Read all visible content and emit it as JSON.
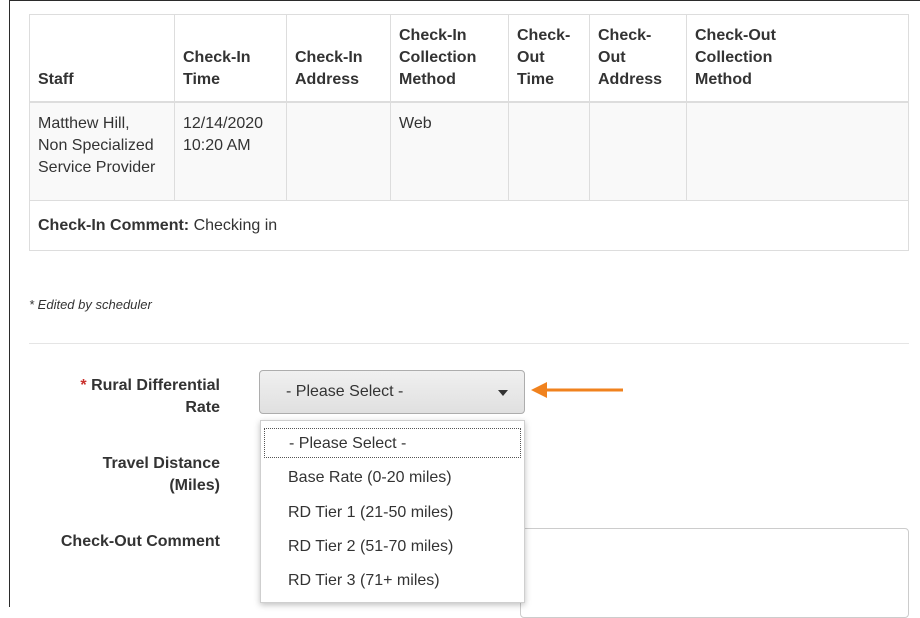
{
  "table": {
    "headers": [
      "Staff",
      "Check-In\nTime",
      "Check-In\nAddress",
      "Check-In\nCollection\nMethod",
      "Check-\nOut\nTime",
      "Check-\nOut\nAddress",
      "Check-Out\nCollection\nMethod"
    ],
    "row": {
      "staff": "Matthew Hill,\nNon Specialized\nService Provider",
      "checkin_time": "12/14/2020\n10:20 AM",
      "checkin_address": "",
      "checkin_method": "Web",
      "checkout_time": "",
      "checkout_address": "",
      "checkout_method": ""
    },
    "comment_label": "Check-In Comment:",
    "comment_value": " Checking in"
  },
  "footnote": "* Edited by scheduler",
  "form": {
    "rural_required_mark": "*",
    "rural_label_line1": "Rural Differential",
    "rural_label_line2": "Rate",
    "travel_label_line1": "Travel Distance",
    "travel_label_line2": "(Miles)",
    "checkout_comment_label": "Check-Out Comment",
    "select_value": "- Please Select -",
    "options": [
      "- Please Select -",
      "Base Rate (0-20 miles)",
      "RD Tier 1 (21-50 miles)",
      "RD Tier 2 (51-70 miles)",
      "RD Tier 3 (71+ miles)"
    ]
  },
  "colors": {
    "annotation_arrow": "#f0821e",
    "required_star": "#c9302c"
  }
}
